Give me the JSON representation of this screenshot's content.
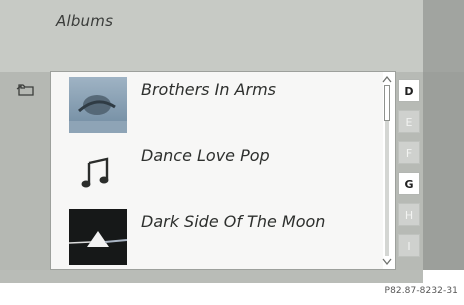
{
  "header": {
    "title": "Albums"
  },
  "list": {
    "items": [
      {
        "label": "Brothers In Arms",
        "art": "album-cover-brothers-in-arms",
        "state": "plain"
      },
      {
        "label": "Dance Love Pop",
        "art": "music-note-icon",
        "state": "plain"
      },
      {
        "label": "Dark Side Of The Moon",
        "art": "album-cover-dark-side",
        "state": "plain"
      }
    ],
    "scroll_position_fraction": 0.0
  },
  "alpha_index": {
    "letters": [
      {
        "letter": "D",
        "active": true
      },
      {
        "letter": "E",
        "active": false
      },
      {
        "letter": "F",
        "active": false
      },
      {
        "letter": "G",
        "active": true
      },
      {
        "letter": "H",
        "active": false
      },
      {
        "letter": "I",
        "active": false
      }
    ]
  },
  "icons": {
    "back": "back-folder-icon"
  },
  "footer": {
    "reference_code": "P82.87-8232-31"
  },
  "colors": {
    "panel_bg": "#b7bab5",
    "list_bg": "#ffffff",
    "active_letter": "#222222",
    "inactive_letter": "#f2f3f1"
  }
}
